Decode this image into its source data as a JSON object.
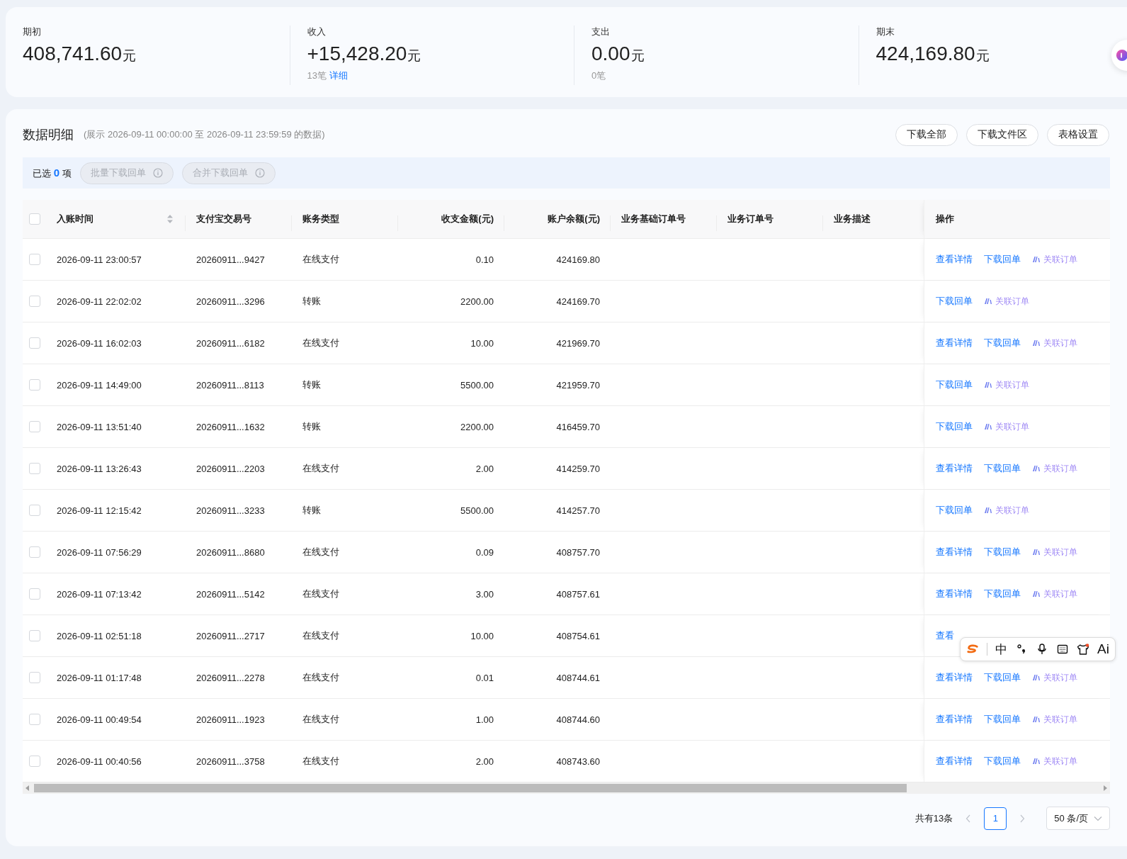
{
  "summary": [
    {
      "label": "期初",
      "value": "408,741.60",
      "unit": "元"
    },
    {
      "label": "收入",
      "value": "+15,428.20",
      "unit": "元",
      "count": "13笔",
      "link": "详细"
    },
    {
      "label": "支出",
      "value": "0.00",
      "unit": "元",
      "count": "0笔"
    },
    {
      "label": "期末",
      "value": "424,169.80",
      "unit": "元"
    }
  ],
  "detail": {
    "title": "数据明细",
    "range": "(展示 2026-09-11 00:00:00 至 2026-09-11 23:59:59 的数据)",
    "buttons": [
      "下载全部",
      "下载文件区",
      "表格设置"
    ]
  },
  "selection": {
    "prefix": "已选",
    "count": "0",
    "suffix": "项",
    "actions": [
      {
        "label": "批量下载回单",
        "disabled": true
      },
      {
        "label": "合并下载回单",
        "disabled": true
      }
    ]
  },
  "table": {
    "select_all": {
      "checked": false
    },
    "columns": [
      "入账时间",
      "支付宝交易号",
      "账务类型",
      "收支金额(元)",
      "账户余额(元)",
      "业务基础订单号",
      "业务订单号",
      "业务描述"
    ],
    "ops_label": "操作",
    "rows": [
      {
        "checked": false,
        "time": "2026-09-11 23:00:57",
        "txid": "20260911...9427",
        "type": "在线支付",
        "amount": "0.10",
        "balance": "424169.80",
        "actions": [
          {
            "kind": "link",
            "text": "查看详情"
          },
          {
            "kind": "link",
            "text": "下载回单"
          },
          {
            "kind": "ai",
            "text": "关联订单"
          }
        ]
      },
      {
        "checked": false,
        "time": "2026-09-11 22:02:02",
        "txid": "20260911...3296",
        "type": "转账",
        "amount": "2200.00",
        "balance": "424169.70",
        "actions": [
          {
            "kind": "link",
            "text": "下载回单"
          },
          {
            "kind": "ai",
            "text": "关联订单"
          }
        ]
      },
      {
        "checked": false,
        "time": "2026-09-11 16:02:03",
        "txid": "20260911...6182",
        "type": "在线支付",
        "amount": "10.00",
        "balance": "421969.70",
        "actions": [
          {
            "kind": "link",
            "text": "查看详情"
          },
          {
            "kind": "link",
            "text": "下载回单"
          },
          {
            "kind": "ai",
            "text": "关联订单"
          }
        ]
      },
      {
        "checked": false,
        "time": "2026-09-11 14:49:00",
        "txid": "20260911...8113",
        "type": "转账",
        "amount": "5500.00",
        "balance": "421959.70",
        "actions": [
          {
            "kind": "link",
            "text": "下载回单"
          },
          {
            "kind": "ai",
            "text": "关联订单"
          }
        ]
      },
      {
        "checked": false,
        "time": "2026-09-11 13:51:40",
        "txid": "20260911...1632",
        "type": "转账",
        "amount": "2200.00",
        "balance": "416459.70",
        "actions": [
          {
            "kind": "link",
            "text": "下载回单"
          },
          {
            "kind": "ai",
            "text": "关联订单"
          }
        ]
      },
      {
        "checked": false,
        "time": "2026-09-11 13:26:43",
        "txid": "20260911...2203",
        "type": "在线支付",
        "amount": "2.00",
        "balance": "414259.70",
        "actions": [
          {
            "kind": "link",
            "text": "查看详情"
          },
          {
            "kind": "link",
            "text": "下载回单"
          },
          {
            "kind": "ai",
            "text": "关联订单"
          }
        ]
      },
      {
        "checked": false,
        "time": "2026-09-11 12:15:42",
        "txid": "20260911...3233",
        "type": "转账",
        "amount": "5500.00",
        "balance": "414257.70",
        "actions": [
          {
            "kind": "link",
            "text": "下载回单"
          },
          {
            "kind": "ai",
            "text": "关联订单"
          }
        ]
      },
      {
        "checked": false,
        "time": "2026-09-11 07:56:29",
        "txid": "20260911...8680",
        "type": "在线支付",
        "amount": "0.09",
        "balance": "408757.70",
        "actions": [
          {
            "kind": "link",
            "text": "查看详情"
          },
          {
            "kind": "link",
            "text": "下载回单"
          },
          {
            "kind": "ai",
            "text": "关联订单"
          }
        ]
      },
      {
        "checked": false,
        "time": "2026-09-11 07:13:42",
        "txid": "20260911...5142",
        "type": "在线支付",
        "amount": "3.00",
        "balance": "408757.61",
        "actions": [
          {
            "kind": "link",
            "text": "查看详情"
          },
          {
            "kind": "link",
            "text": "下载回单"
          },
          {
            "kind": "ai",
            "text": "关联订单"
          }
        ]
      },
      {
        "checked": false,
        "time": "2026-09-11 02:51:18",
        "txid": "20260911...2717",
        "type": "在线支付",
        "amount": "10.00",
        "balance": "408754.61",
        "actions": [
          {
            "kind": "link",
            "text": "查看"
          }
        ]
      },
      {
        "checked": false,
        "time": "2026-09-11 01:17:48",
        "txid": "20260911...2278",
        "type": "在线支付",
        "amount": "0.01",
        "balance": "408744.61",
        "actions": [
          {
            "kind": "link",
            "text": "查看详情"
          },
          {
            "kind": "link",
            "text": "下载回单"
          },
          {
            "kind": "ai",
            "text": "关联订单"
          }
        ]
      },
      {
        "checked": false,
        "time": "2026-09-11 00:49:54",
        "txid": "20260911...1923",
        "type": "在线支付",
        "amount": "1.00",
        "balance": "408744.60",
        "actions": [
          {
            "kind": "link",
            "text": "查看详情"
          },
          {
            "kind": "link",
            "text": "下载回单"
          },
          {
            "kind": "ai",
            "text": "关联订单"
          }
        ]
      },
      {
        "checked": false,
        "time": "2026-09-11 00:40:56",
        "txid": "20260911...3758",
        "type": "在线支付",
        "amount": "2.00",
        "balance": "408743.60",
        "actions": [
          {
            "kind": "link",
            "text": "查看详情"
          },
          {
            "kind": "link",
            "text": "下载回单"
          },
          {
            "kind": "ai",
            "text": "关联订单"
          }
        ]
      }
    ]
  },
  "pagination": {
    "total": "共有13条",
    "pages": [
      {
        "label": "1",
        "selected": true
      }
    ],
    "page_size": "50 条/页"
  },
  "ime_toolbar": {
    "lang": "中",
    "ai": "Ai"
  }
}
